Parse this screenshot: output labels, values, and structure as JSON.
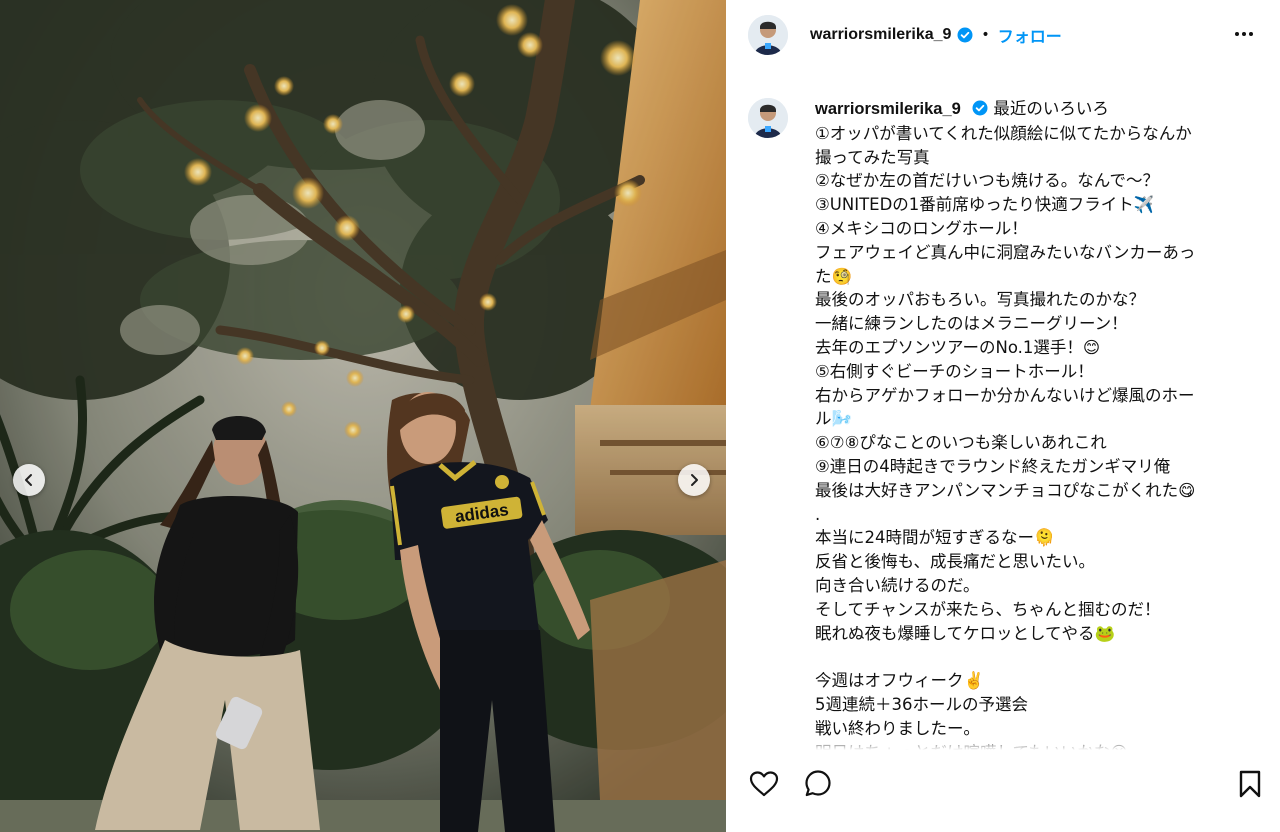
{
  "post": {
    "username": "warriorsmilerika_9",
    "verified": true,
    "separator": "•",
    "follow_label": "フォロー",
    "more_icon": "more-horizontal-icon"
  },
  "caption": {
    "username": "warriorsmilerika_9",
    "first_line_text": "最近のいろいろ",
    "lines": [
      "①オッパが書いてくれた似顔絵に似てたからなんか",
      "撮ってみた写真",
      "②なぜか左の首だけいつも焼ける。なんで〜？",
      "③UNITEDの1番前席ゆったり快適フライト✈️",
      "④メキシコのロングホール！",
      "フェアウェイど真ん中に洞窟みたいなバンカーあっ",
      "た🧐",
      "最後のオッパおもろい。写真撮れたのかな？",
      "一緒に練ランしたのはメラニーグリーン！",
      "去年のエプソンツアーのNo.1選手！😊",
      "⑤右側すぐビーチのショートホール！",
      "右からアゲかフォローか分かんないけど爆風のホー",
      "ル🌬️",
      "⑥⑦⑧ぴなことのいつも楽しいあれこれ",
      "⑨連日の4時起きでラウンド終えたガンギマリ俺",
      "最後は大好きアンパンマンチョコぴなこがくれた😋",
      ".",
      "本当に24時間が短すぎるなー🫠",
      "反省と後悔も、成長痛だと思いたい。",
      "向き合い続けるのだ。",
      "そしてチャンスが来たら、ちゃんと掴むのだ！",
      "眠れぬ夜も爆睡してケロッとしてやる🐸",
      "",
      "今週はオフウィーク✌️",
      "5週連続＋36ホールの予選会",
      "戦い終わりましたー。",
      "明日はちょっとだけ喧嘩してもいいかな😆"
    ]
  },
  "actions": {
    "like_icon": "heart-icon",
    "comment_icon": "comment-icon",
    "save_icon": "bookmark-icon"
  },
  "carousel": {
    "prev_icon": "chevron-left-icon",
    "next_icon": "chevron-right-icon"
  },
  "photo": {
    "jersey_text": "adidas"
  },
  "colors": {
    "link_blue": "#0095f6",
    "verified_blue": "#0095f6",
    "text": "#111111"
  }
}
